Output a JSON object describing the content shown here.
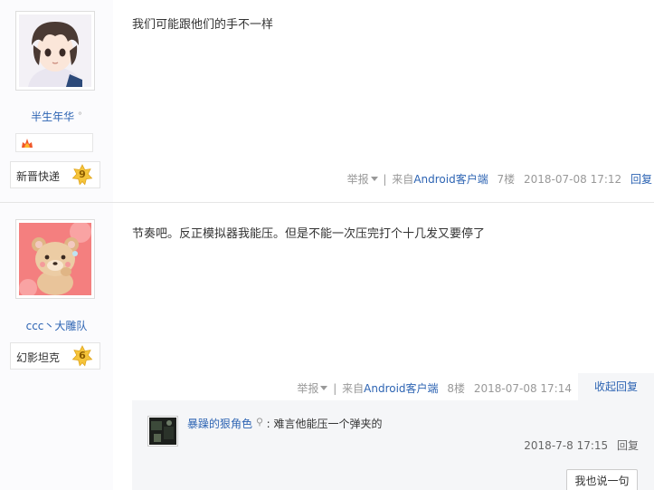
{
  "posts": [
    {
      "username": "半生年华",
      "badge_icon": "fire-badge-icon",
      "level_name": "新晋快递",
      "level": "9",
      "content": "我们可能跟他们的手不一样",
      "report": "举报",
      "from_prefix": "来自",
      "client": "Android客户端",
      "floor": "7楼",
      "time": "2018-07-08 17:12",
      "reply": "回复"
    },
    {
      "username": "ccc丶大雕队",
      "level_name": "幻影坦克",
      "level": "6",
      "content": "节奏吧。反正模拟器我能压。但是不能一次压完打个十几发又要停了",
      "report": "举报",
      "from_prefix": "来自",
      "client": "Android客户端",
      "floor": "8楼",
      "time": "2018-07-08 17:14",
      "collapse_reply": "收起回复",
      "sub_reply": {
        "username": "暴躁的狠角色",
        "text": "难言他能压一个弹夹的",
        "time": "2018-7-8 17:15",
        "reply": "回复",
        "say_button": "我也说一句"
      }
    }
  ],
  "colors": {
    "link": "#2d64b3",
    "meta": "#999999",
    "sidebar_bg": "#fbfbfd",
    "lzl_bg": "#f5f6f8",
    "level_star": "#f5c43a"
  }
}
